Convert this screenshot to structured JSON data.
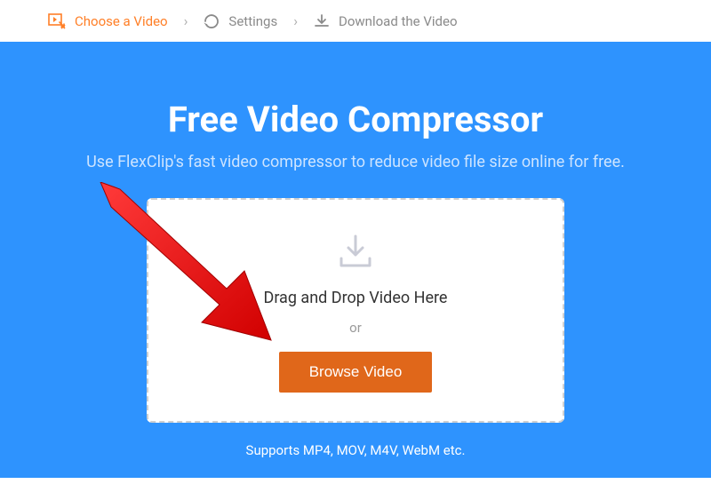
{
  "steps": {
    "choose": "Choose a Video",
    "settings": "Settings",
    "download": "Download the Video"
  },
  "hero": {
    "title": "Free Video Compressor",
    "subtitle": "Use FlexClip's fast video compressor to reduce video file size online for free."
  },
  "dropzone": {
    "instruction": "Drag and Drop Video Here",
    "or": "or",
    "browse_label": "Browse Video"
  },
  "supports": "Supports MP4, MOV, M4V, WebM etc.",
  "colors": {
    "accent_orange": "#ff7f27",
    "button_orange": "#e0671a",
    "hero_blue": "#2e93fe",
    "arrow_red": "#ec1c24"
  }
}
